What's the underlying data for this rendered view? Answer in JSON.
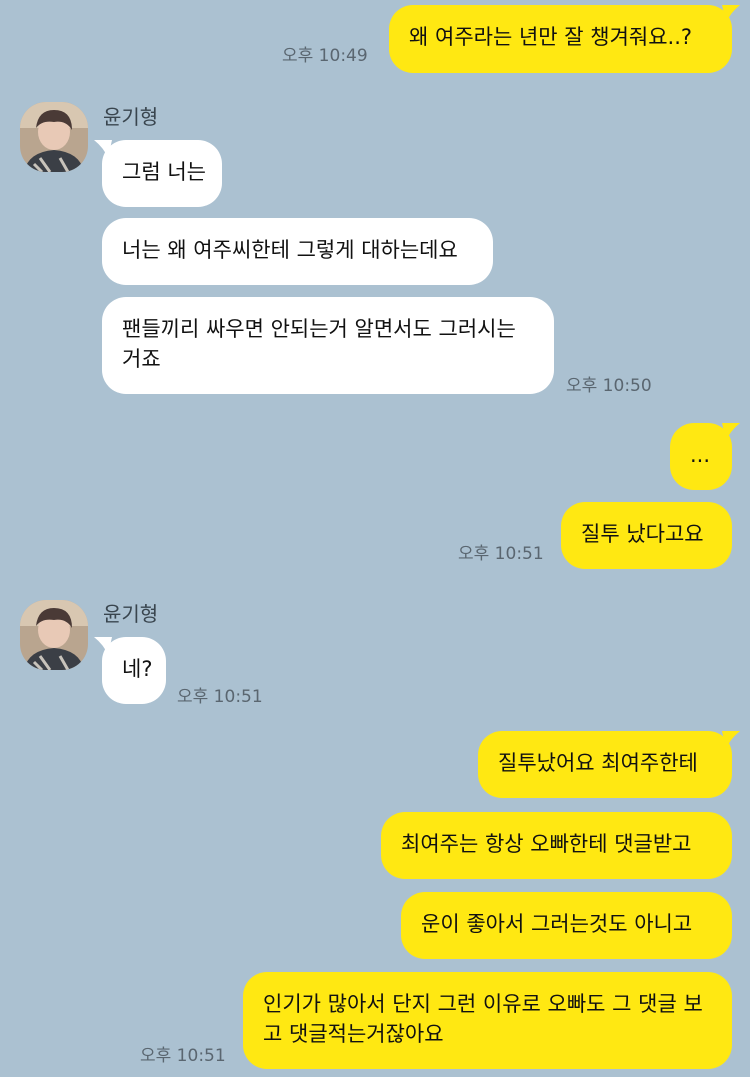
{
  "colors": {
    "background": "#abc1d1",
    "my_bubble": "#ffe812",
    "their_bubble": "#ffffff"
  },
  "contact": {
    "name": "윤기형",
    "avatar_icon": "profile-photo"
  },
  "messages": [
    {
      "from": "me",
      "text": "왜 여주라는 년만 잘 챙겨줘요..?",
      "time": "오후 10:49"
    },
    {
      "from": "them",
      "text": "그럼 너는",
      "time": ""
    },
    {
      "from": "them",
      "text": "너는 왜 여주씨한테 그렇게 대하는데요",
      "time": ""
    },
    {
      "from": "them",
      "text": "팬들끼리 싸우면 안되는거 알면서도 그러시는거죠",
      "time": "오후 10:50"
    },
    {
      "from": "me",
      "text": "...",
      "time": ""
    },
    {
      "from": "me",
      "text": "질투 났다고요",
      "time": "오후 10:51"
    },
    {
      "from": "them",
      "text": "네?",
      "time": "오후 10:51"
    },
    {
      "from": "me",
      "text": "질투났어요 최여주한테",
      "time": ""
    },
    {
      "from": "me",
      "text": "최여주는 항상 오빠한테 댓글받고",
      "time": ""
    },
    {
      "from": "me",
      "text": "운이 좋아서 그러는것도 아니고",
      "time": ""
    },
    {
      "from": "me",
      "text": "인기가 많아서 단지 그런 이유로 오빠도 그 댓글 보고 댓글적는거잖아요",
      "time": "오후 10:51"
    }
  ]
}
